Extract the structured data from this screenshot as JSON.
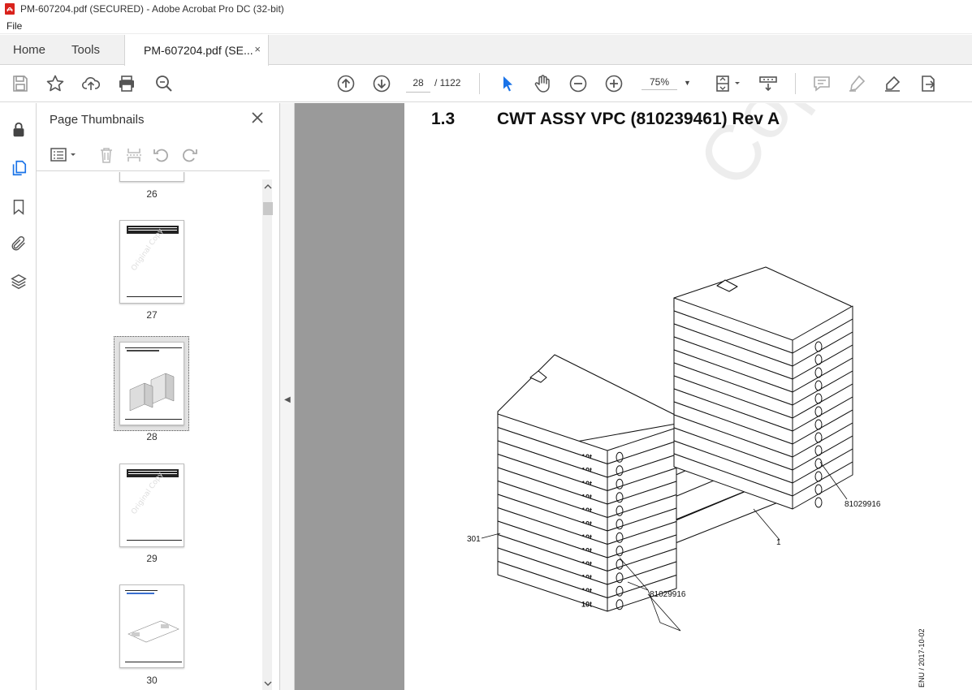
{
  "window": {
    "title": "PM-607204.pdf (SECURED) - Adobe Acrobat Pro DC (32-bit)"
  },
  "menu": {
    "items": [
      "File"
    ]
  },
  "tabs": {
    "home": "Home",
    "tools": "Tools",
    "document": "PM-607204.pdf (SE...",
    "close": "×"
  },
  "toolbar": {
    "current_page": "28",
    "total_pages": "/ 1122",
    "zoom": "75%",
    "icons": [
      "save-icon",
      "star-icon",
      "upload-icon",
      "print-icon",
      "zoom-search-icon",
      "prev-page-icon",
      "next-page-icon",
      "select-cursor-icon",
      "hand-icon",
      "zoom-out-icon",
      "zoom-in-icon",
      "fit-page-icon",
      "scrolling-icon",
      "comment-icon",
      "highlight-icon",
      "sign-icon",
      "export-icon"
    ]
  },
  "left_rail": {
    "icons": [
      "lock-icon",
      "pages-icon",
      "bookmark-icon",
      "attachment-icon",
      "layers-icon"
    ]
  },
  "thumbnails_panel": {
    "title": "Page Thumbnails",
    "pages": [
      {
        "label": "26"
      },
      {
        "label": "27"
      },
      {
        "label": "28",
        "selected": true
      },
      {
        "label": "29"
      },
      {
        "label": "30"
      }
    ]
  },
  "page": {
    "section_number": "1.3",
    "section_title": "CWT ASSY VPC (810239461) Rev A",
    "watermark": "Copy",
    "callouts": {
      "part_301": "301",
      "part_1": "1",
      "part_right_bracket": "81029916",
      "part_bottom_bracket": "81029916"
    },
    "weight_label": "10t",
    "footer_code": "ENU / 2017-10-02"
  },
  "colors": {
    "accent_blue": "#1a73e8",
    "doc_bg": "#9a9a9a",
    "icon_gray": "#5a5a5a",
    "pdf_red": "#d9221c"
  }
}
